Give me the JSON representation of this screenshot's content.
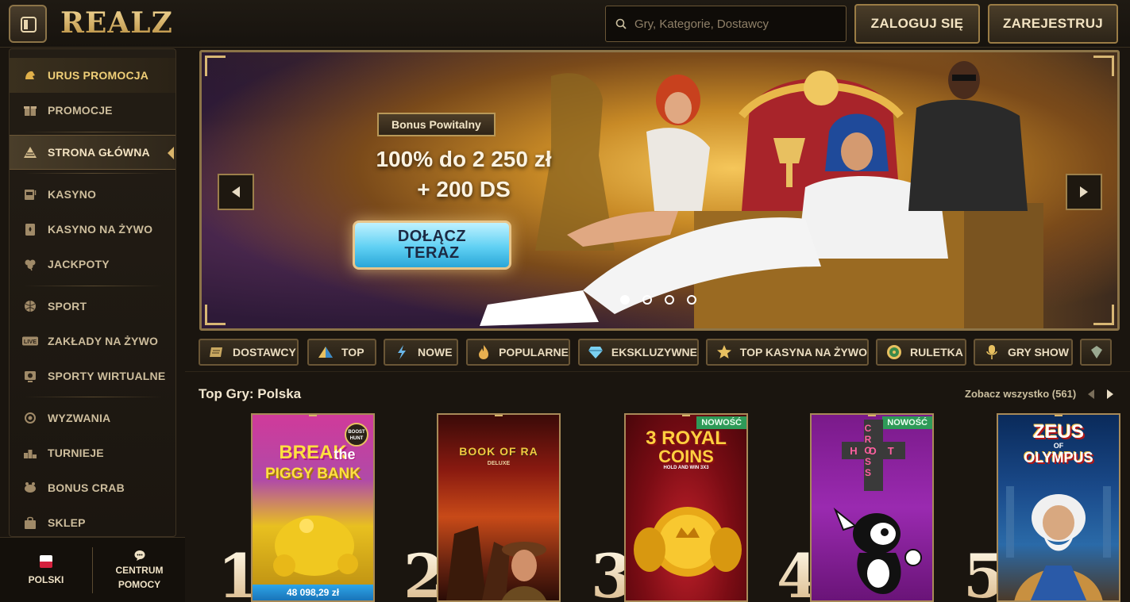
{
  "header": {
    "logo": "REALZ",
    "search_placeholder": "Gry, Kategorie, Dostawcy",
    "login_label": "ZALOGUJ SIĘ",
    "register_label": "ZAREJESTRUJ"
  },
  "sidebar": {
    "items": [
      {
        "label": "URUS PROMOCJA",
        "icon": "helmet-icon"
      },
      {
        "label": "PROMOCJE",
        "icon": "gift-icon"
      },
      {
        "label": "STRONA GŁÓWNA",
        "icon": "pyramid-icon"
      },
      {
        "label": "KASYNO",
        "icon": "slot-machine-icon"
      },
      {
        "label": "KASYNO NA ŻYWO",
        "icon": "card-icon"
      },
      {
        "label": "JACKPOTY",
        "icon": "clover-icon"
      },
      {
        "label": "SPORT",
        "icon": "ball-icon"
      },
      {
        "label": "ZAKŁADY NA ŻYWO",
        "icon": "live-icon"
      },
      {
        "label": "SPORTY WIRTUALNE",
        "icon": "virtual-ball-icon"
      },
      {
        "label": "WYZWANIA",
        "icon": "medal-icon"
      },
      {
        "label": "TURNIEJE",
        "icon": "podium-icon"
      },
      {
        "label": "BONUS CRAB",
        "icon": "crab-icon"
      },
      {
        "label": "SKLEP",
        "icon": "bag-icon"
      }
    ]
  },
  "footer": {
    "language": "POLSKI",
    "help_line1": "CENTRUM",
    "help_line2": "POMOCY"
  },
  "banner": {
    "badge": "Bonus Powitalny",
    "line1": "100% do 2 250 zł",
    "line2": "+ 200 DS",
    "cta_line1": "DOŁĄCZ",
    "cta_line2": "TERAZ",
    "active_slide": 1,
    "slide_count": 4
  },
  "categories": [
    {
      "label": "DOSTAWCY",
      "icon": "scroll-icon"
    },
    {
      "label": "TOP",
      "icon": "pyramid-icon"
    },
    {
      "label": "NOWE",
      "icon": "lightning-icon"
    },
    {
      "label": "POPULARNE",
      "icon": "flame-icon"
    },
    {
      "label": "EKSKLUZYWNE",
      "icon": "diamond-icon"
    },
    {
      "label": "TOP KASYNA NA ŻYWO",
      "icon": "star-icon"
    },
    {
      "label": "RULETKA",
      "icon": "roulette-icon"
    },
    {
      "label": "GRY SHOW",
      "icon": "microphone-icon"
    }
  ],
  "top_games": {
    "title": "Top Gry: Polska",
    "see_all": "Zobacz wszystko (561)",
    "games": [
      {
        "rank": "1",
        "title_line1": "BREAK",
        "title_line2": "the",
        "title_line3": "PIGGY BANK",
        "provider_badge": "BOOST HUNT",
        "jackpot": "48 098,29 zł"
      },
      {
        "rank": "2",
        "title_line1": "BOOK OF RA",
        "title_line2": "DELUXE"
      },
      {
        "rank": "3",
        "title_line1": "3 ROYAL",
        "title_line2": "COINS",
        "title_line3": "HOLD AND WIN 3X3",
        "tag": "NOWOŚĆ"
      },
      {
        "rank": "4",
        "title_line1": "HOT",
        "title_line2": "CROSS",
        "tag": "NOWOŚĆ"
      },
      {
        "rank": "5",
        "title_line1": "ZEUS",
        "title_line2": "OF",
        "title_line3": "OLYMPUS"
      }
    ]
  },
  "colors": {
    "gold": "#d9b46a",
    "background": "#1a150f",
    "new_tag": "#2e9a58",
    "cta_blue": "#5fd0f3"
  }
}
